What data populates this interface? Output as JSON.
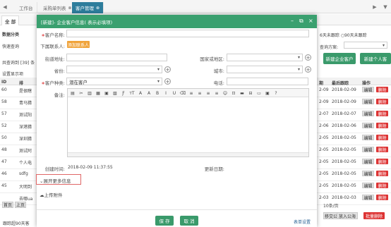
{
  "topbar": {
    "tabs": [
      {
        "label": "工作台",
        "active": false
      },
      {
        "label": "采购单列表",
        "active": false
      },
      {
        "label": "客户管理",
        "active": true
      }
    ],
    "left_arrow": "◀",
    "right_arrow": "▶",
    "menu_arrow": "▼"
  },
  "background": {
    "tabs": [
      "全 部",
      "数据分类",
      "快速查询"
    ],
    "count_text": "共查询到 [39] 条",
    "settings_text": "设置显示项",
    "col_id": "ID",
    "col_name": "排",
    "col_date": "最后跟踪",
    "col_action": "操作",
    "col_no": "期",
    "right_filter": "6天未跟踪 ○90天未跟踪",
    "query_plan_label": "查询方案:",
    "new_company_btn": "新建企业客户",
    "new_person_btn": "新建个人客",
    "rows": [
      {
        "id": "60",
        "name": "是很瞎",
        "no": "2-09",
        "date": "2018-02-09"
      },
      {
        "id": "58",
        "name": "青马猜",
        "no": "2-09",
        "date": "2018-02-09"
      },
      {
        "id": "57",
        "name": "测试阳",
        "no": "2-07",
        "date": "2018-02-07"
      },
      {
        "id": "52",
        "name": "深港猜",
        "no": "2-06",
        "date": "2018-02-06"
      },
      {
        "id": "50",
        "name": "深圳猜",
        "no": "2-05",
        "date": "2018-02-05"
      },
      {
        "id": "48",
        "name": "测试阿",
        "no": "2-05",
        "date": "2018-02-05"
      },
      {
        "id": "47",
        "name": "个人电",
        "no": "2-05",
        "date": "2018-02-05"
      },
      {
        "id": "46",
        "name": "sdfg",
        "no": "2-05",
        "date": "2018-02-05"
      },
      {
        "id": "45",
        "name": "大明到",
        "no": "2-05",
        "date": "2018-02-05"
      },
      {
        "id": "",
        "name": "去哪ua",
        "no": "2-03",
        "date": "2018-02-03"
      }
    ],
    "edit_label": "编辑",
    "delete_label": "删除",
    "pager_first": "首页",
    "pager_prev": "上页",
    "pager_size": "10条/页",
    "bottom_status": "跟踪超90天客",
    "bottom_btn1": "移交公海",
    "bottom_btn2": "放入公海",
    "bottom_btn3": "批量删除"
  },
  "modal": {
    "title": "[新建]- 企业客户信息( 表示必填项)",
    "fields": {
      "customer_name_label": "客户名称:",
      "contact_label": "下属联系人:",
      "add_contact_btn": "添加联系人",
      "address_label": "街道地址:",
      "country_label": "国家或地区:",
      "province_label": "省份:",
      "city_label": "城市:",
      "customer_type_label": "客户种类:",
      "customer_type_value": "潜在客户",
      "phone_label": "电话:",
      "remark_label": "备注:",
      "created_label": "创建时间:",
      "created_value": "2018-02-09 11:37:55",
      "updated_label": "更新日期:",
      "expand_label": "展开更多信息",
      "upload_label": "上传附件"
    },
    "editor_tools": [
      "▤",
      "✂",
      "▥",
      "▦",
      "▣",
      "▧",
      "Ƒ",
      "ᴛT",
      "A",
      "A",
      "B",
      "I",
      "U",
      "⌫",
      "≡",
      "≡",
      "≡",
      "≡",
      "☺",
      "⊡",
      "▬",
      "⊟",
      "▭",
      "▣",
      "?"
    ],
    "save_btn": "保 存",
    "cancel_btn": "取 消",
    "form_settings": "表单设置"
  },
  "colors": {
    "accent": "#3aa06f",
    "tab_active": "#2e7d9c",
    "required": "#d33333",
    "orange": "#f0a33a"
  }
}
